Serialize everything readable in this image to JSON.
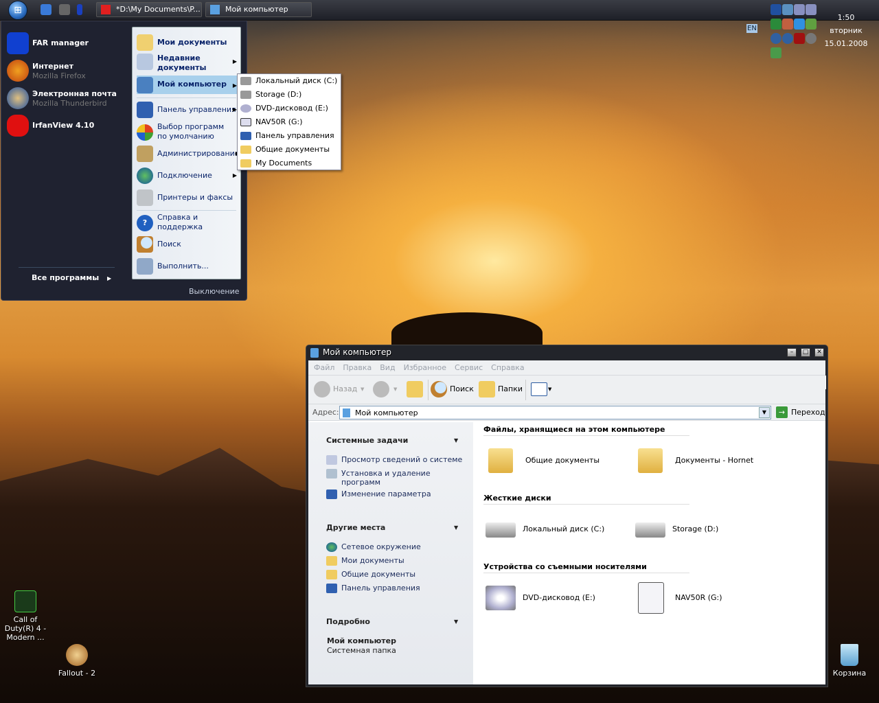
{
  "taskbar": {
    "start": "start",
    "tasks": [
      "*D:\\My Documents\\P...",
      "Мой компьютер"
    ],
    "lang": "EN",
    "clock": {
      "time": "1:50",
      "day": "вторник",
      "date": "15.01.2008"
    }
  },
  "start_menu": {
    "pinned": [
      {
        "title": "FAR manager",
        "sub": ""
      },
      {
        "title": "Интернет",
        "sub": "Mozilla Firefox"
      },
      {
        "title": "Электронная почта",
        "sub": "Mozilla Thunderbird"
      },
      {
        "title": "IrfanView 4.10",
        "sub": ""
      }
    ],
    "all_programs": "Все программы",
    "places": [
      {
        "label": "Мои документы"
      },
      {
        "label": "Недавние документы"
      },
      {
        "label": "Мой компьютер"
      },
      {
        "label": "Панель управления"
      },
      {
        "label": "Выбор программ по умолчанию"
      },
      {
        "label": "Администрирование"
      },
      {
        "label": "Подключение"
      },
      {
        "label": "Принтеры и факсы"
      },
      {
        "label": "Справка и поддержка"
      },
      {
        "label": "Поиск"
      },
      {
        "label": "Выполнить..."
      }
    ],
    "shutdown": "Выключение",
    "submenu": [
      "Локальный диск (C:)",
      "Storage (D:)",
      "DVD-дисковод (E:)",
      "NAV50R (G:)",
      "Панель управления",
      "Общие документы",
      "My Documents"
    ]
  },
  "desktop": {
    "icons": [
      "Call of Duty(R) 4 - Modern ...",
      "Fallout - 2",
      "Корзина"
    ]
  },
  "explorer": {
    "title": "Мой компьютер",
    "menu": [
      "Файл",
      "Правка",
      "Вид",
      "Избранное",
      "Сервис",
      "Справка"
    ],
    "toolbar": {
      "back": "Назад",
      "search": "Поиск",
      "folders": "Папки"
    },
    "address_label": "Адрес:",
    "address": "Мой компьютер",
    "go": "Переход",
    "tasks": {
      "title": "Системные задачи",
      "items": [
        "Просмотр сведений о системе",
        "Установка и удаление программ",
        "Изменение параметра"
      ]
    },
    "other": {
      "title": "Другие места",
      "items": [
        "Сетевое окружение",
        "Мои документы",
        "Общие документы",
        "Панель управления"
      ]
    },
    "details": {
      "title": "Подробно",
      "name": "Мой компьютер",
      "desc": "Системная папка"
    },
    "groups": [
      {
        "title": "Файлы, хранящиеся на этом компьютере",
        "items": [
          "Общие документы",
          "Документы - Hornet"
        ]
      },
      {
        "title": "Жесткие диски",
        "items": [
          "Локальный диск (C:)",
          "Storage (D:)"
        ]
      },
      {
        "title": "Устройства со съемными носителями",
        "items": [
          "DVD-дисковод (E:)",
          "NAV50R (G:)"
        ]
      }
    ]
  }
}
